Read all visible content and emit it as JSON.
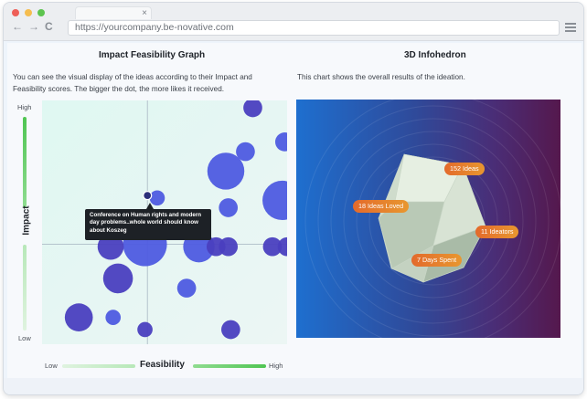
{
  "browser": {
    "url": "https://yourcompany.be-novative.com",
    "tab_close": "×",
    "nav_back": "←",
    "nav_forward": "→",
    "nav_reload": "C",
    "traffic_colors": [
      "#ee5f58",
      "#f5bd4f",
      "#5dc44f"
    ]
  },
  "impact_graph": {
    "title": "Impact Feasibility Graph",
    "description_line1": "You can see the visual display of the ideas according to their Impact and",
    "description_line2": "Feasibility scores. The bigger the dot, the more likes it received.",
    "y_axis_label": "Impact",
    "y_high": "High",
    "y_low": "Low",
    "x_axis_label": "Feasibility",
    "x_low": "Low",
    "x_high": "High",
    "tooltip_line1": "Conference on Human rights and modern",
    "tooltip_line2": "day problems..whole world should know",
    "tooltip_line3": "about Koszeg",
    "dot_color": "#4e5be0",
    "dot_color_dark": "#4a3fbf",
    "axis_bar_color": "#57c95a"
  },
  "chart_data": {
    "type": "scatter",
    "xlabel": "Feasibility",
    "ylabel": "Impact",
    "xlim": [
      0,
      100
    ],
    "ylim": [
      0,
      100
    ],
    "grid": false,
    "points": [
      {
        "x": 86,
        "y": 97,
        "likes": 2,
        "tone": "dark"
      },
      {
        "x": 99,
        "y": 83,
        "likes": 2,
        "tone": "light"
      },
      {
        "x": 83,
        "y": 79,
        "likes": 2,
        "tone": "light"
      },
      {
        "x": 75,
        "y": 71,
        "likes": 12,
        "tone": "light"
      },
      {
        "x": 98,
        "y": 59,
        "likes": 14,
        "tone": "light"
      },
      {
        "x": 47,
        "y": 60,
        "likes": 1,
        "tone": "light"
      },
      {
        "x": 76,
        "y": 56,
        "likes": 2,
        "tone": "light"
      },
      {
        "x": 25,
        "y": 48,
        "likes": 3,
        "tone": "light"
      },
      {
        "x": 42,
        "y": 41,
        "likes": 18,
        "tone": "light"
      },
      {
        "x": 63,
        "y": 49,
        "likes": 3,
        "tone": "light"
      },
      {
        "x": 64,
        "y": 40,
        "likes": 8,
        "tone": "light"
      },
      {
        "x": 28,
        "y": 40,
        "likes": 5,
        "tone": "dark"
      },
      {
        "x": 71,
        "y": 40,
        "likes": 2,
        "tone": "dark"
      },
      {
        "x": 76,
        "y": 40,
        "likes": 2,
        "tone": "dark"
      },
      {
        "x": 94,
        "y": 40,
        "likes": 2,
        "tone": "dark"
      },
      {
        "x": 100,
        "y": 40,
        "likes": 2,
        "tone": "dark"
      },
      {
        "x": 31,
        "y": 27,
        "likes": 7,
        "tone": "dark"
      },
      {
        "x": 59,
        "y": 23,
        "likes": 2,
        "tone": "light"
      },
      {
        "x": 15,
        "y": 11,
        "likes": 6,
        "tone": "dark"
      },
      {
        "x": 29,
        "y": 11,
        "likes": 1,
        "tone": "light"
      },
      {
        "x": 42,
        "y": 6,
        "likes": 1,
        "tone": "dark"
      },
      {
        "x": 77,
        "y": 6,
        "likes": 2,
        "tone": "dark"
      }
    ],
    "selected_point": {
      "x": 43,
      "y": 61
    }
  },
  "infohedron": {
    "title": "3D Infohedron",
    "description": "This chart shows the overall results of the ideation.",
    "labels": {
      "ideas": "152 Ideas",
      "loved": "18 Ideas Loved",
      "ideators": "11 Ideators",
      "days": "7 Days Spent"
    }
  }
}
